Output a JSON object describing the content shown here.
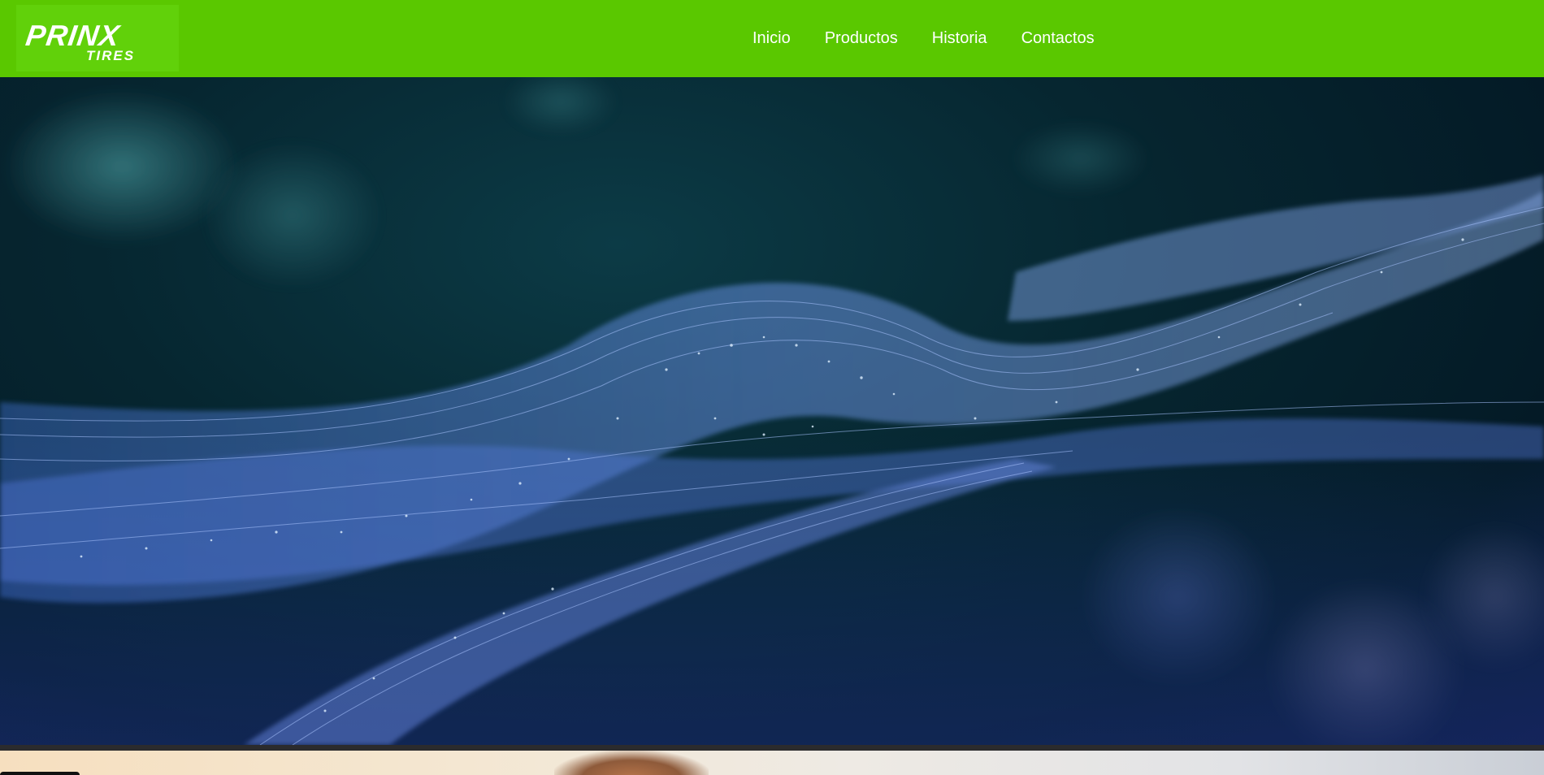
{
  "brand": {
    "logo_main": "PRINX",
    "logo_sub": "TIRES"
  },
  "nav": {
    "items": [
      {
        "label": "Inicio"
      },
      {
        "label": "Productos"
      },
      {
        "label": "Historia"
      },
      {
        "label": "Contactos"
      }
    ]
  },
  "colors": {
    "header_bg": "#5ac800",
    "logo_bg": "#61d10a",
    "nav_text": "#ffffff",
    "hero_bg": "#062630",
    "hero_particles": "#6f8ff0",
    "divider": "#2b2b2d"
  }
}
